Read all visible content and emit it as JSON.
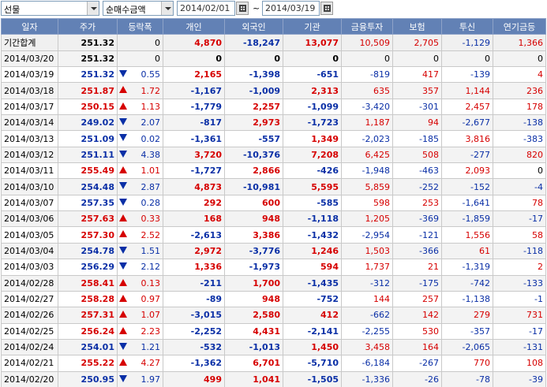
{
  "toolbar": {
    "market_select": "선물",
    "type_select": "순매수금액",
    "start_date": "2014/02/01",
    "end_date": "2014/03/19",
    "tilde": "~"
  },
  "table": {
    "headers": [
      "일자",
      "주가",
      "등락폭",
      "개인",
      "외국인",
      "기관",
      "금융투자",
      "보험",
      "투신",
      "연기금등"
    ],
    "rows": [
      {
        "date": "기간합계",
        "price": "251.32",
        "dir": "",
        "change": "0",
        "indiv": "4,870",
        "foreign": "-18,247",
        "inst": "13,077",
        "fin": "10,509",
        "ins": "2,705",
        "trust": "-1,129",
        "pension": "1,366"
      },
      {
        "date": "2014/03/20",
        "price": "251.32",
        "dir": "",
        "change": "0",
        "indiv": "0",
        "foreign": "0",
        "inst": "0",
        "fin": "0",
        "ins": "0",
        "trust": "0",
        "pension": "0"
      },
      {
        "date": "2014/03/19",
        "price": "251.32",
        "dir": "down",
        "change": "0.55",
        "indiv": "2,165",
        "foreign": "-1,398",
        "inst": "-651",
        "fin": "-819",
        "ins": "417",
        "trust": "-139",
        "pension": "4"
      },
      {
        "date": "2014/03/18",
        "price": "251.87",
        "dir": "up",
        "change": "1.72",
        "indiv": "-1,167",
        "foreign": "-1,009",
        "inst": "2,313",
        "fin": "635",
        "ins": "357",
        "trust": "1,144",
        "pension": "236"
      },
      {
        "date": "2014/03/17",
        "price": "250.15",
        "dir": "up",
        "change": "1.13",
        "indiv": "-1,779",
        "foreign": "2,257",
        "inst": "-1,099",
        "fin": "-3,420",
        "ins": "-301",
        "trust": "2,457",
        "pension": "178"
      },
      {
        "date": "2014/03/14",
        "price": "249.02",
        "dir": "down",
        "change": "2.07",
        "indiv": "-817",
        "foreign": "2,973",
        "inst": "-1,723",
        "fin": "1,187",
        "ins": "94",
        "trust": "-2,677",
        "pension": "-138"
      },
      {
        "date": "2014/03/13",
        "price": "251.09",
        "dir": "down",
        "change": "0.02",
        "indiv": "-1,361",
        "foreign": "-557",
        "inst": "1,349",
        "fin": "-2,023",
        "ins": "-185",
        "trust": "3,816",
        "pension": "-383"
      },
      {
        "date": "2014/03/12",
        "price": "251.11",
        "dir": "down",
        "change": "4.38",
        "indiv": "3,720",
        "foreign": "-10,376",
        "inst": "7,208",
        "fin": "6,425",
        "ins": "508",
        "trust": "-277",
        "pension": "820"
      },
      {
        "date": "2014/03/11",
        "price": "255.49",
        "dir": "up",
        "change": "1.01",
        "indiv": "-1,727",
        "foreign": "2,866",
        "inst": "-426",
        "fin": "-1,948",
        "ins": "-463",
        "trust": "2,093",
        "pension": "0"
      },
      {
        "date": "2014/03/10",
        "price": "254.48",
        "dir": "down",
        "change": "2.87",
        "indiv": "4,873",
        "foreign": "-10,981",
        "inst": "5,595",
        "fin": "5,859",
        "ins": "-252",
        "trust": "-152",
        "pension": "-4"
      },
      {
        "date": "2014/03/07",
        "price": "257.35",
        "dir": "down",
        "change": "0.28",
        "indiv": "292",
        "foreign": "600",
        "inst": "-585",
        "fin": "598",
        "ins": "253",
        "trust": "-1,641",
        "pension": "78"
      },
      {
        "date": "2014/03/06",
        "price": "257.63",
        "dir": "up",
        "change": "0.33",
        "indiv": "168",
        "foreign": "948",
        "inst": "-1,118",
        "fin": "1,205",
        "ins": "-369",
        "trust": "-1,859",
        "pension": "-17"
      },
      {
        "date": "2014/03/05",
        "price": "257.30",
        "dir": "up",
        "change": "2.52",
        "indiv": "-2,613",
        "foreign": "3,386",
        "inst": "-1,432",
        "fin": "-2,954",
        "ins": "-121",
        "trust": "1,556",
        "pension": "58"
      },
      {
        "date": "2014/03/04",
        "price": "254.78",
        "dir": "down",
        "change": "1.51",
        "indiv": "2,972",
        "foreign": "-3,776",
        "inst": "1,246",
        "fin": "1,503",
        "ins": "-366",
        "trust": "61",
        "pension": "-118"
      },
      {
        "date": "2014/03/03",
        "price": "256.29",
        "dir": "down",
        "change": "2.12",
        "indiv": "1,336",
        "foreign": "-1,973",
        "inst": "594",
        "fin": "1,737",
        "ins": "21",
        "trust": "-1,319",
        "pension": "2"
      },
      {
        "date": "2014/02/28",
        "price": "258.41",
        "dir": "up",
        "change": "0.13",
        "indiv": "-211",
        "foreign": "1,700",
        "inst": "-1,435",
        "fin": "-312",
        "ins": "-175",
        "trust": "-742",
        "pension": "-133"
      },
      {
        "date": "2014/02/27",
        "price": "258.28",
        "dir": "up",
        "change": "0.97",
        "indiv": "-89",
        "foreign": "948",
        "inst": "-752",
        "fin": "144",
        "ins": "257",
        "trust": "-1,138",
        "pension": "-1"
      },
      {
        "date": "2014/02/26",
        "price": "257.31",
        "dir": "up",
        "change": "1.07",
        "indiv": "-3,015",
        "foreign": "2,580",
        "inst": "412",
        "fin": "-662",
        "ins": "142",
        "trust": "279",
        "pension": "731"
      },
      {
        "date": "2014/02/25",
        "price": "256.24",
        "dir": "up",
        "change": "2.23",
        "indiv": "-2,252",
        "foreign": "4,431",
        "inst": "-2,141",
        "fin": "-2,255",
        "ins": "530",
        "trust": "-357",
        "pension": "-17"
      },
      {
        "date": "2014/02/24",
        "price": "254.01",
        "dir": "down",
        "change": "1.21",
        "indiv": "-532",
        "foreign": "-1,013",
        "inst": "1,450",
        "fin": "3,458",
        "ins": "164",
        "trust": "-2,065",
        "pension": "-131"
      },
      {
        "date": "2014/02/21",
        "price": "255.22",
        "dir": "up",
        "change": "4.27",
        "indiv": "-1,362",
        "foreign": "6,701",
        "inst": "-5,710",
        "fin": "-6,184",
        "ins": "-267",
        "trust": "770",
        "pension": "108"
      },
      {
        "date": "2014/02/20",
        "price": "250.95",
        "dir": "down",
        "change": "1.97",
        "indiv": "499",
        "foreign": "1,041",
        "inst": "-1,505",
        "fin": "-1,336",
        "ins": "-26",
        "trust": "-78",
        "pension": "-39"
      }
    ]
  },
  "colors": {
    "header_bg": "#6281b5",
    "up": "#d60000",
    "down": "#0a2fa6"
  }
}
